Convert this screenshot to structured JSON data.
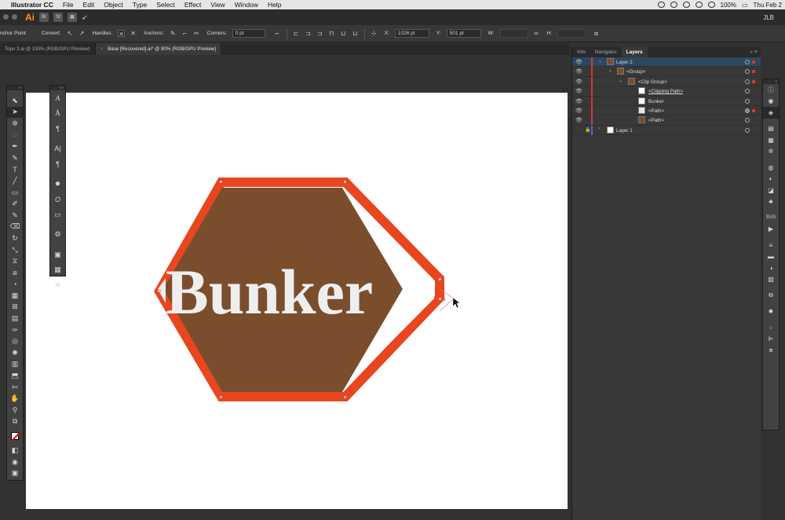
{
  "menubar": {
    "app_name": "Illustrator CC",
    "items": [
      "File",
      "Edit",
      "Object",
      "Type",
      "Select",
      "Effect",
      "View",
      "Window",
      "Help"
    ],
    "battery": "100%",
    "clock": "Thu Feb 2"
  },
  "appbar": {
    "logo": "Ai",
    "bridge": "Br",
    "stock": "St",
    "user": "JLB"
  },
  "controlbar": {
    "tool_label": "nchor Point",
    "convert_label": "Convert:",
    "handles_label": "Handles:",
    "anchors_label": "Anchors:",
    "corners_label": "Corners:",
    "corners_value": "0 pt",
    "x_label": "X:",
    "x_value": "1026 pt",
    "y_label": "Y:",
    "y_value": "501 pt",
    "w_label": "W:",
    "h_label": "H:"
  },
  "doc_tabs": [
    {
      "label": "Topo 3.ai @ 150% (RGB/GPU Preview)",
      "active": false
    },
    {
      "label": "Base [Recovered].ai* @ 90% (RGB/GPU Preview)",
      "active": true
    }
  ],
  "artwork": {
    "text": "Bunker",
    "fill_color": "#7a4e2d",
    "stroke_color": "#e8461e",
    "text_color": "#efeeee"
  },
  "layers_panel": {
    "tabs": [
      "Info",
      "Navigator",
      "Layers"
    ],
    "active_tab": "Layers",
    "rows": [
      {
        "name": "Layer 2",
        "level": 0,
        "expanded": true,
        "selected": true
      },
      {
        "name": "<Group>",
        "level": 1,
        "expanded": true,
        "selected": false
      },
      {
        "name": "<Clip Group>",
        "level": 2,
        "expanded": true,
        "selected": false
      },
      {
        "name": "<Clipping Path>",
        "level": 3,
        "expanded": false,
        "selected": false
      },
      {
        "name": "Bunker",
        "level": 3,
        "expanded": false,
        "selected": false
      },
      {
        "name": "<Path>",
        "level": 3,
        "expanded": false,
        "selected": false
      },
      {
        "name": "<Path>",
        "level": 3,
        "expanded": false,
        "selected": false
      },
      {
        "name": "Layer 1",
        "level": 0,
        "expanded": false,
        "selected": false
      }
    ]
  },
  "colors": {
    "layer2_color": "#d23a3a",
    "layer1_color": "#4a6cd4",
    "accent": "#ff9a00"
  }
}
